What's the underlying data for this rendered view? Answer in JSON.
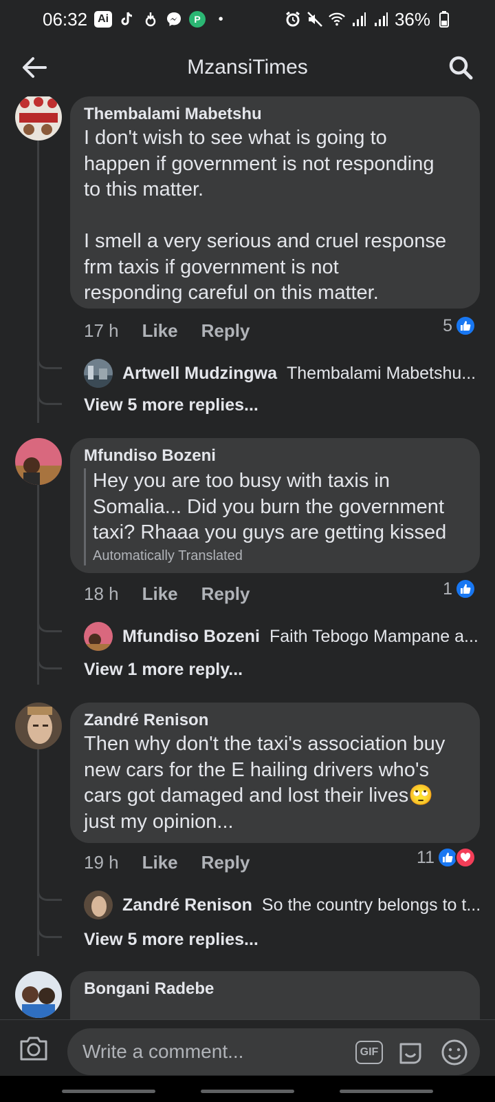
{
  "status_bar": {
    "time": "06:32",
    "battery": "36%",
    "icons_left": [
      "ai-icon",
      "tiktok-icon",
      "download-icon",
      "messenger-icon",
      "pocket-icon",
      "dot"
    ],
    "icons_right": [
      "alarm-icon",
      "mute-icon",
      "wifi-icon",
      "signal-icon",
      "signal-icon",
      "battery-icon"
    ]
  },
  "header": {
    "title": "MzansiTimes",
    "back_icon": "arrow-left-icon",
    "search_icon": "search-icon"
  },
  "comments": [
    {
      "author": "Thembalami Mabetshu",
      "text": "I don't wish to see what is going to\nhappen if government is not responding\nto this matter.\n\nI smell a very serious and cruel response\nfrm taxis if government is not\nresponding careful on this matter.",
      "time": "17 h",
      "like": "Like",
      "reply": "Reply",
      "reaction_count": "5",
      "reply_preview": {
        "author": "Artwell Mudzingwa",
        "text": "Thembalami Mabetshu..."
      },
      "more": "View 5 more replies..."
    },
    {
      "author": "Mfundiso Bozeni",
      "text": "Hey you are too busy with taxis in\nSomalia... Did you burn the government\ntaxi? Rhaaa you guys are getting kissed",
      "translated_label": "Automatically Translated",
      "time": "18 h",
      "like": "Like",
      "reply": "Reply",
      "reaction_count": "1",
      "reply_preview": {
        "author": "Mfundiso Bozeni",
        "text": "Faith Tebogo Mampane a..."
      },
      "more": "View 1 more reply..."
    },
    {
      "author": "Zandré Renison",
      "text": "Then why don't the taxi's association buy\nnew cars for the E hailing drivers who's\ncars got damaged and lost their lives",
      "text_tail": "just my opinion...",
      "emoji": "🙄",
      "time": "19 h",
      "like": "Like",
      "reply": "Reply",
      "reaction_count": "11",
      "reply_preview": {
        "author": "Zandré Renison",
        "text": "So the country belongs to t..."
      },
      "more": "View 5 more replies..."
    },
    {
      "author": "Bongani Radebe"
    }
  ],
  "composer": {
    "placeholder": "Write a comment...",
    "gif_label": "GIF",
    "camera_icon": "camera-icon",
    "sticker_icon": "sticker-icon",
    "emoji_icon": "emoji-icon"
  },
  "colors": {
    "background": "#242526",
    "bubble": "#3a3b3c",
    "text_primary": "#e4e6eb",
    "text_secondary": "#b0b3b8",
    "like_blue": "#1877f2",
    "love_red": "#f33e58"
  }
}
